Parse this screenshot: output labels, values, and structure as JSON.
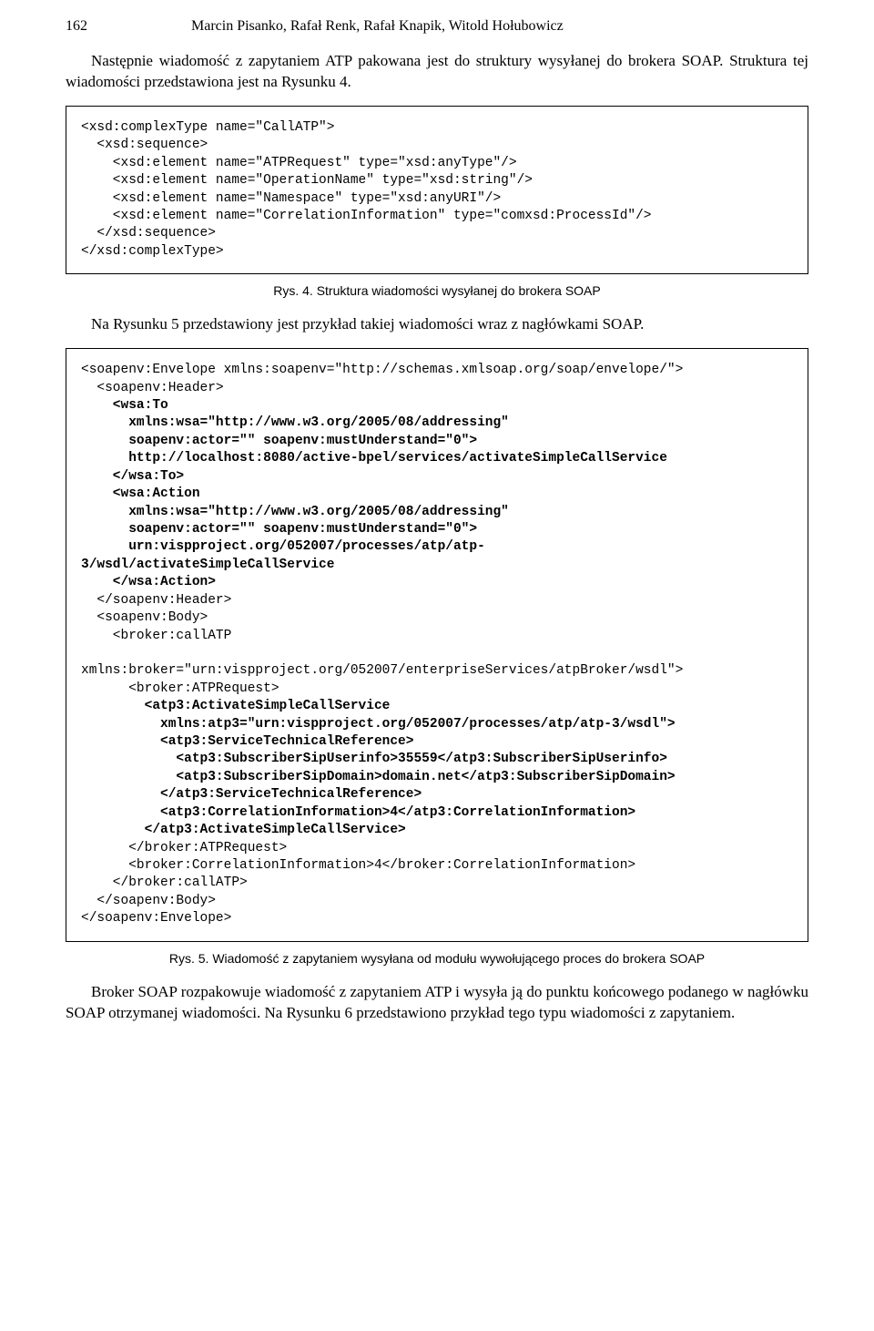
{
  "header": {
    "page_number": "162",
    "authors": "Marcin Pisanko, Rafał Renk, Rafał Knapik, Witold Hołubowicz"
  },
  "para1": "Następnie wiadomość z zapytaniem ATP pakowana jest do struktury wysyłanej do brokera SOAP. Struktura tej wiadomości przedstawiona jest na Rysunku 4.",
  "code1": "<xsd:complexType name=\"CallATP\">\n  <xsd:sequence>\n    <xsd:element name=\"ATPRequest\" type=\"xsd:anyType\"/>\n    <xsd:element name=\"OperationName\" type=\"xsd:string\"/>\n    <xsd:element name=\"Namespace\" type=\"xsd:anyURI\"/>\n    <xsd:element name=\"CorrelationInformation\" type=\"comxsd:ProcessId\"/>\n  </xsd:sequence>\n</xsd:complexType>",
  "caption1": "Rys. 4. Struktura wiadomości wysyłanej do brokera SOAP",
  "para2": "Na Rysunku 5 przedstawiony jest przykład takiej wiadomości wraz z nagłówkami SOAP.",
  "code2_plain_lines": [
    "<soapenv:Envelope xmlns:soapenv=\"http://schemas.xmlsoap.org/soap/envelope/\">",
    "  <soapenv:Header>",
    "  </soapenv:Header>",
    "  <soapenv:Body>",
    "    <broker:callATP",
    "",
    "xmlns:broker=\"urn:vispproject.org/052007/enterpriseServices/atpBroker/wsdl\">",
    "      <broker:ATPRequest>",
    "      </broker:ATPRequest>",
    "      <broker:CorrelationInformation>4</broker:CorrelationInformation>",
    "    </broker:callATP>",
    "  </soapenv:Body>",
    "</soapenv:Envelope>"
  ],
  "code2_bold_blocks": {
    "wsa_to": "    <wsa:To\n      xmlns:wsa=\"http://www.w3.org/2005/08/addressing\"\n      soapenv:actor=\"\" soapenv:mustUnderstand=\"0\">\n      http://localhost:8080/active-bpel/services/activateSimpleCallService\n    </wsa:To>\n    <wsa:Action\n      xmlns:wsa=\"http://www.w3.org/2005/08/addressing\"\n      soapenv:actor=\"\" soapenv:mustUnderstand=\"0\">\n      urn:vispproject.org/052007/processes/atp/atp-\n3/wsdl/activateSimpleCallService\n    </wsa:Action>",
    "atp3": "        <atp3:ActivateSimpleCallService\n          xmlns:atp3=\"urn:vispproject.org/052007/processes/atp/atp-3/wsdl\">\n          <atp3:ServiceTechnicalReference>\n            <atp3:SubscriberSipUserinfo>35559</atp3:SubscriberSipUserinfo>\n            <atp3:SubscriberSipDomain>domain.net</atp3:SubscriberSipDomain>\n          </atp3:ServiceTechnicalReference>\n          <atp3:CorrelationInformation>4</atp3:CorrelationInformation>\n        </atp3:ActivateSimpleCallService>"
  },
  "caption2": "Rys. 5. Wiadomość z zapytaniem wysyłana od modułu wywołującego proces do brokera SOAP",
  "para3": "Broker SOAP rozpakowuje wiadomość z zapytaniem ATP i wysyła ją do punktu końcowego podanego w nagłówku SOAP otrzymanej wiadomości. Na Rysunku 6 przedstawiono przykład tego typu wiadomości z zapytaniem."
}
